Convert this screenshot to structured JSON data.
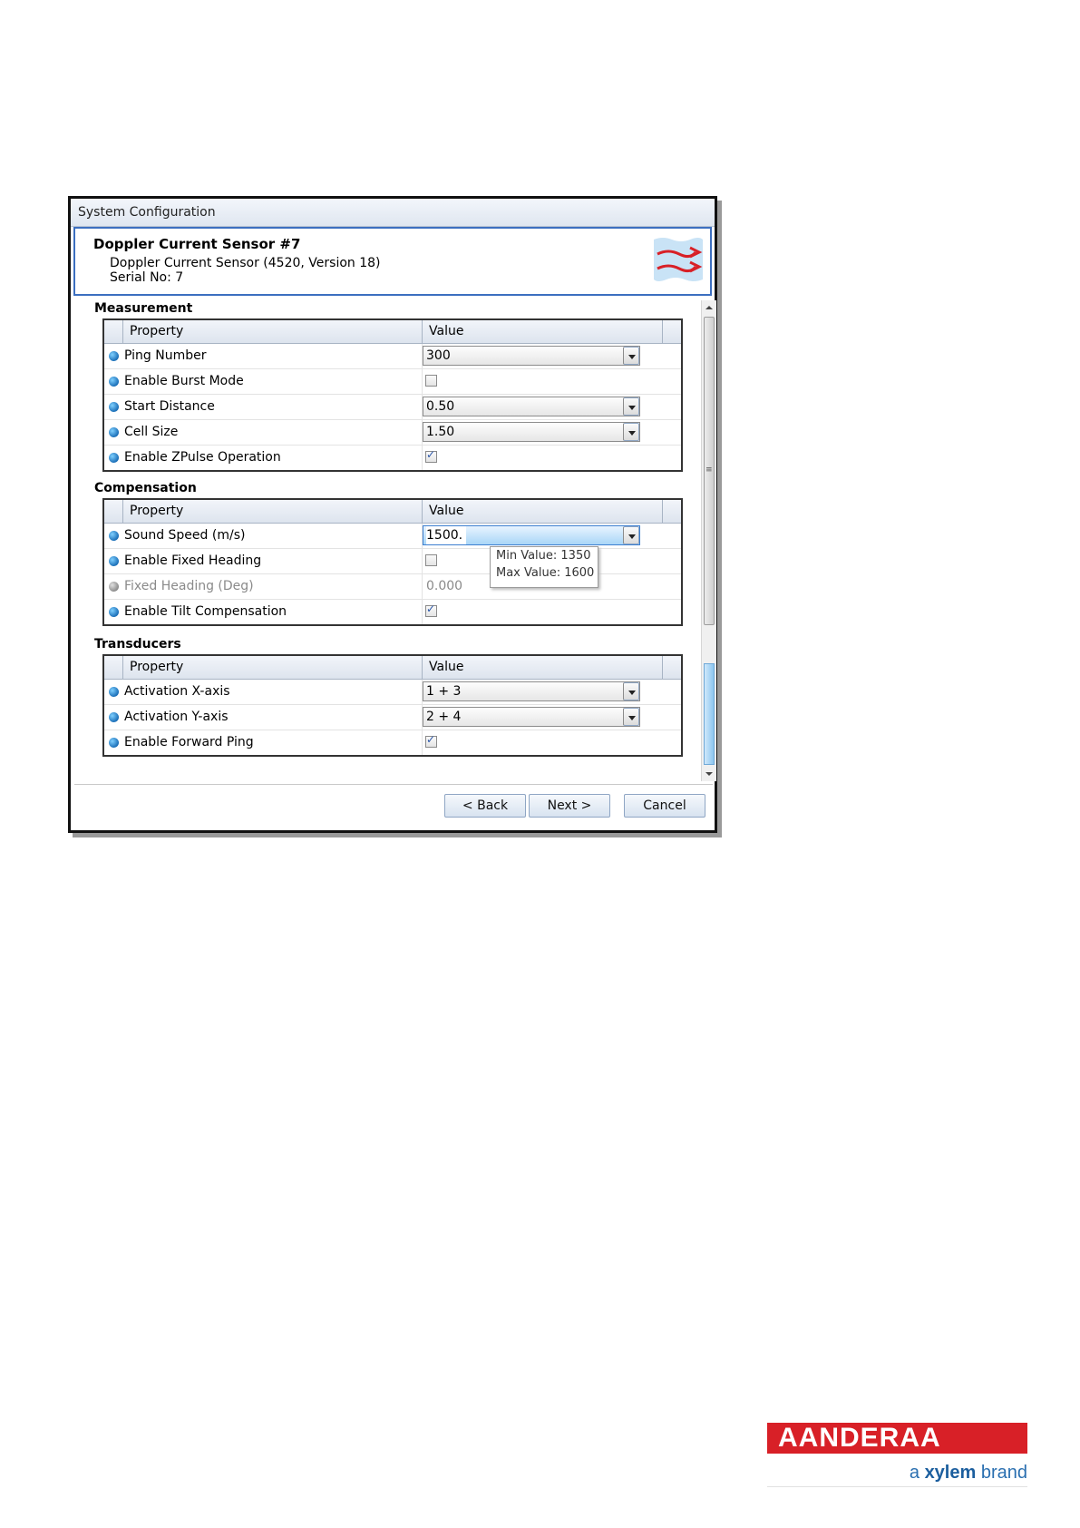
{
  "window": {
    "title": "System Configuration"
  },
  "header": {
    "title": "Doppler Current Sensor #7",
    "subtitle": "Doppler Current Sensor (4520, Version 18)",
    "serial": "Serial No: 7",
    "icon": "current-arrows-icon"
  },
  "columns": {
    "property": "Property",
    "value": "Value"
  },
  "sections": {
    "measurement": {
      "title": "Measurement",
      "rows": [
        {
          "label": "Ping Number",
          "value": "300"
        },
        {
          "label": "Enable Burst Mode",
          "checked": false
        },
        {
          "label": "Start Distance",
          "value": "0.50"
        },
        {
          "label": "Cell Size",
          "value": "1.50"
        },
        {
          "label": "Enable ZPulse Operation",
          "checked": true
        }
      ]
    },
    "compensation": {
      "title": "Compensation",
      "rows": [
        {
          "label": "Sound Speed (m/s)",
          "value": "1500."
        },
        {
          "label": "Enable Fixed Heading",
          "checked": false
        },
        {
          "label": "Fixed Heading (Deg)",
          "value": "0.000",
          "disabled": true
        },
        {
          "label": "Enable Tilt Compensation",
          "checked": true
        }
      ]
    },
    "transducers": {
      "title": "Transducers",
      "rows": [
        {
          "label": "Activation X-axis",
          "value": "1 + 3"
        },
        {
          "label": "Activation Y-axis",
          "value": "2 + 4"
        },
        {
          "label": "Enable Forward Ping",
          "checked": true
        }
      ]
    }
  },
  "tooltip": {
    "min": "Min Value: 1350",
    "max": "Max Value: 1600"
  },
  "buttons": {
    "back": "< Back",
    "next": "Next >",
    "cancel": "Cancel"
  },
  "logo": {
    "word": "AANDERAA",
    "tag_prefix": "a",
    "tag_brand": "xylem",
    "tag_suffix": "brand"
  },
  "colors": {
    "accent": "#3c6fc0",
    "logo_red": "#d82027",
    "logo_blue": "#2a6fb0"
  }
}
